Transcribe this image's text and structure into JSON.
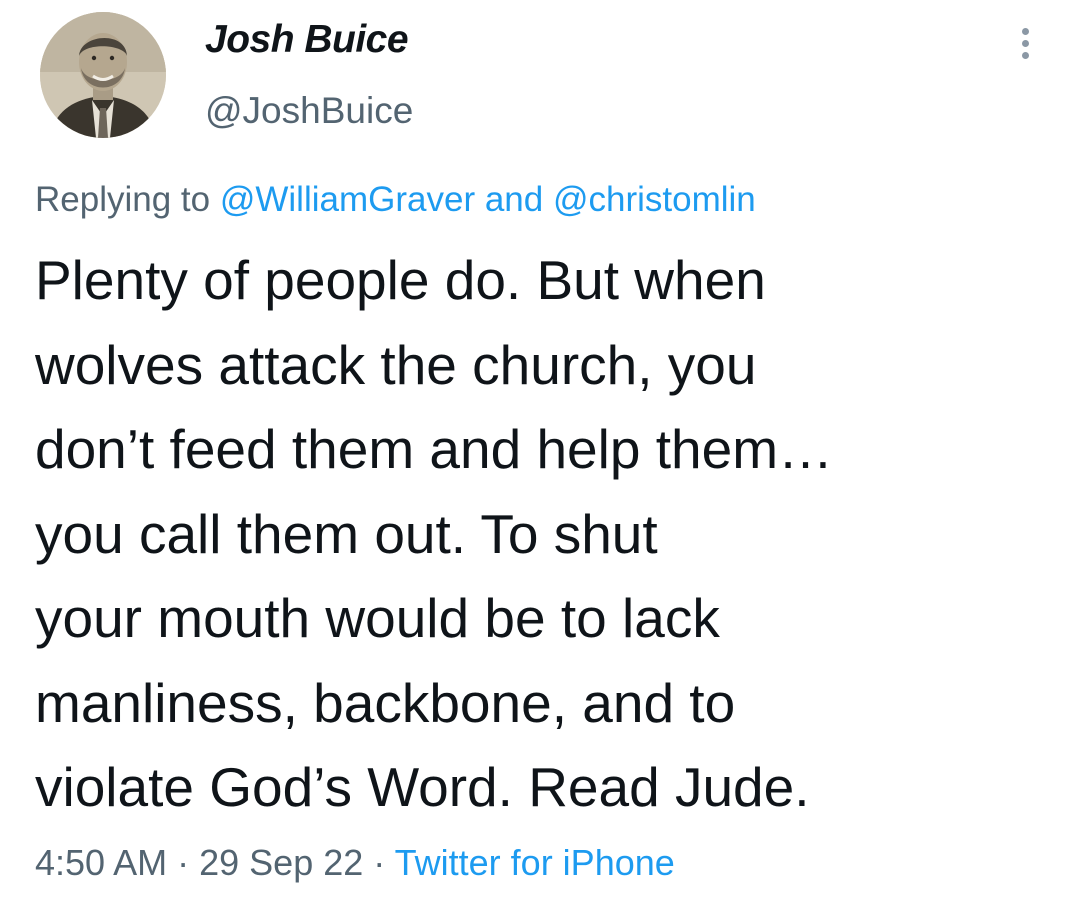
{
  "author": {
    "display_name": "Josh Buice",
    "handle": "@JoshBuice",
    "avatar_icon": "user-avatar-photo"
  },
  "menu": {
    "icon": "more-vertical-icon"
  },
  "reply": {
    "prefix": "Replying to",
    "mention_1": "@WilliamGraver",
    "joiner": "and",
    "mention_2": "@christomlin"
  },
  "tweet": {
    "lines": [
      "Plenty of people do. But when",
      "wolves attack the church, you",
      "don’t feed them and help them…",
      "you call them out. To shut",
      "your mouth would be to lack",
      "manliness, backbone, and to",
      "violate God’s Word. Read Jude."
    ]
  },
  "meta": {
    "time": "4:50 AM",
    "separator": "·",
    "date": "29 Sep 22",
    "source": "Twitter for iPhone"
  },
  "colors": {
    "text": "#0f1419",
    "secondary": "#536471",
    "link": "#1d9bf0"
  }
}
